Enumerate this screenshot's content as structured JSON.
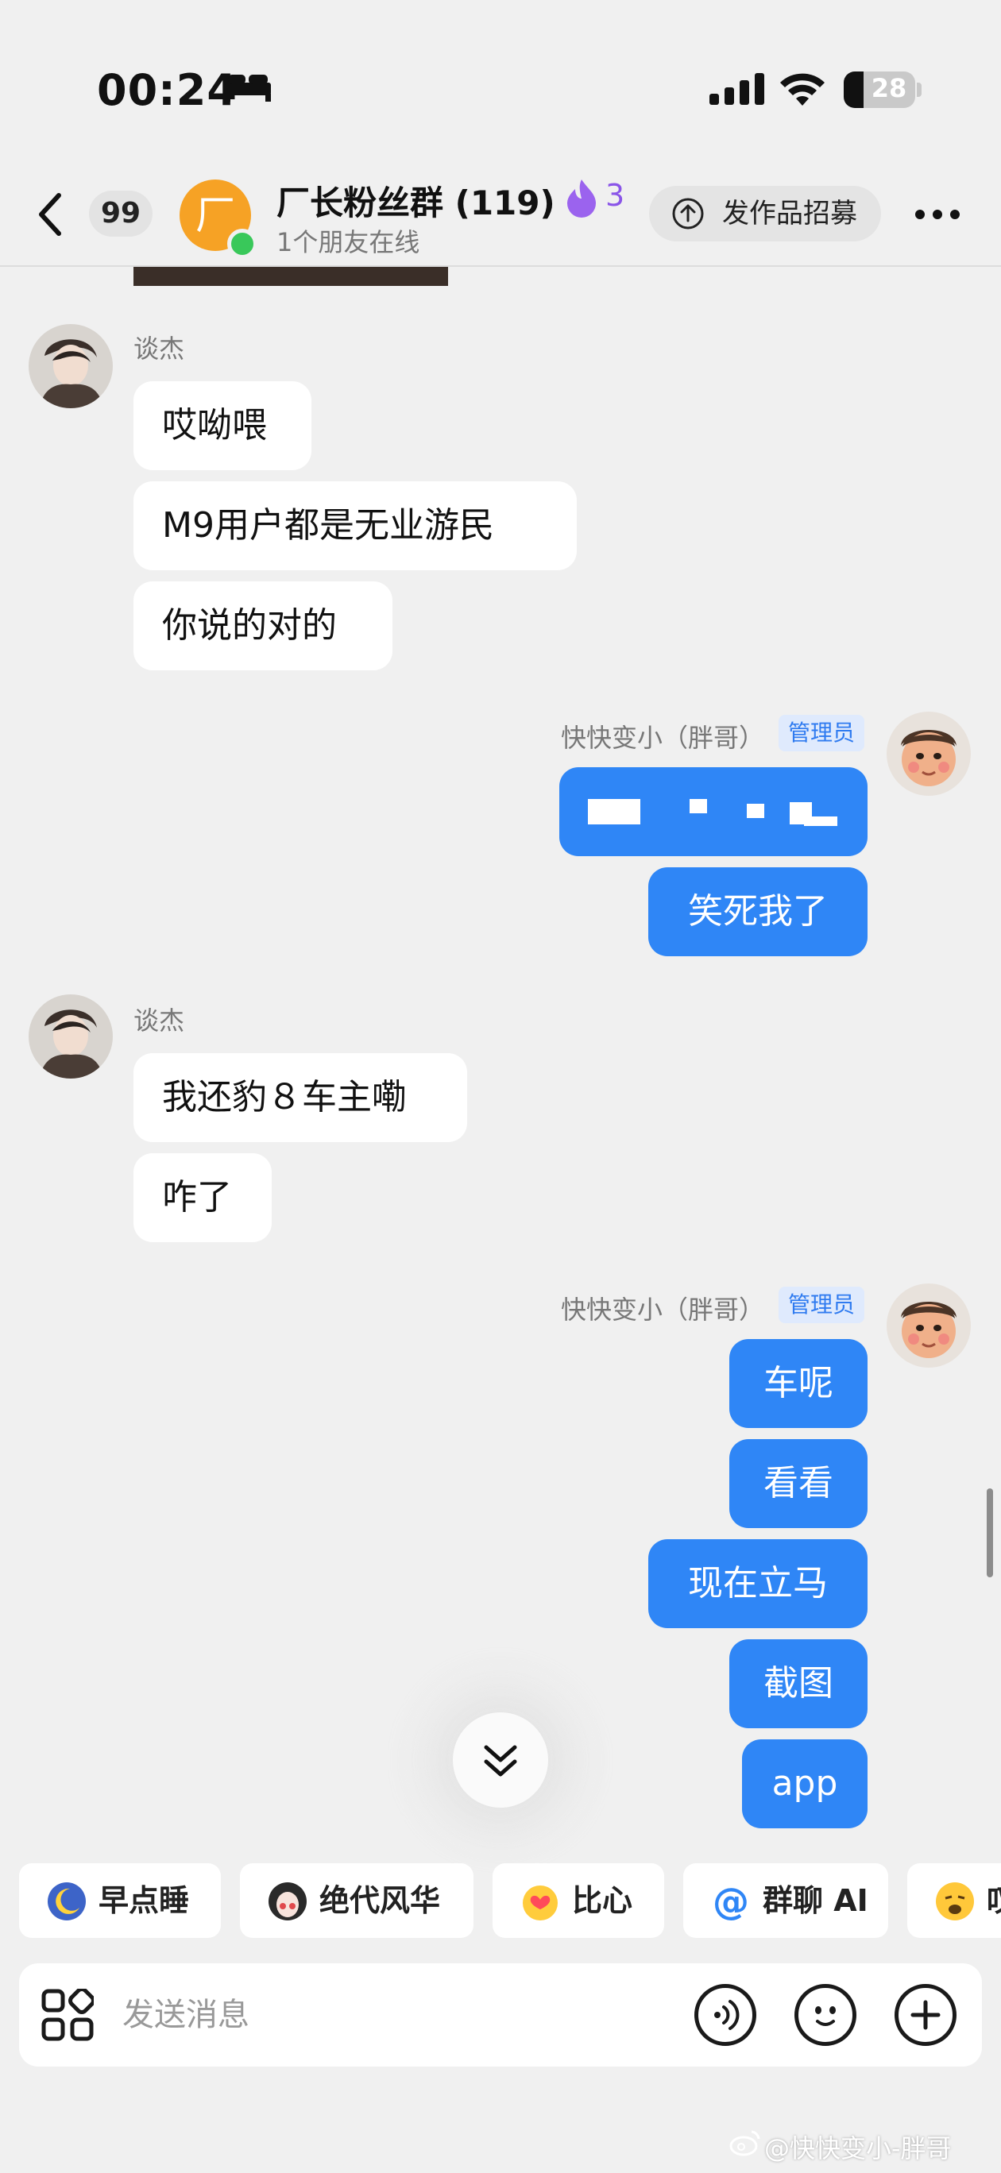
{
  "status_bar": {
    "time": "00:24",
    "battery": "28",
    "battery_level_pct": 28
  },
  "header": {
    "unread_count": "99",
    "group_avatar_text": "厂",
    "title": "厂长粉丝群 (119)",
    "fire_count": "3",
    "subtitle": "1个朋友在线",
    "recruit_label": "发作品招募"
  },
  "messages": {
    "sender_a": "谈杰",
    "sender_b": "快快变小（胖哥）",
    "admin_label": "管理员",
    "group1": [
      "哎呦喂",
      "M9用户都是无业游民",
      "你说的对的"
    ],
    "group2": [
      "笑死我了"
    ],
    "group3": [
      "我还豹８车主嘞",
      "咋了"
    ],
    "group4": [
      "车呢",
      "看看",
      "现在立马",
      "截图",
      "app"
    ]
  },
  "quick_replies": [
    "早点睡",
    "绝代风华",
    "比心",
    "群聊 AI",
    "叹"
  ],
  "composer": {
    "placeholder": "发送消息"
  },
  "watermark": "@快快变小-胖哥",
  "colors": {
    "outgoing_bubble": "#2f86f6",
    "admin_badge": "#2f7bf0",
    "online": "#39c85a",
    "group_avatar": "#f6a225",
    "fire": "#8a55e8"
  }
}
